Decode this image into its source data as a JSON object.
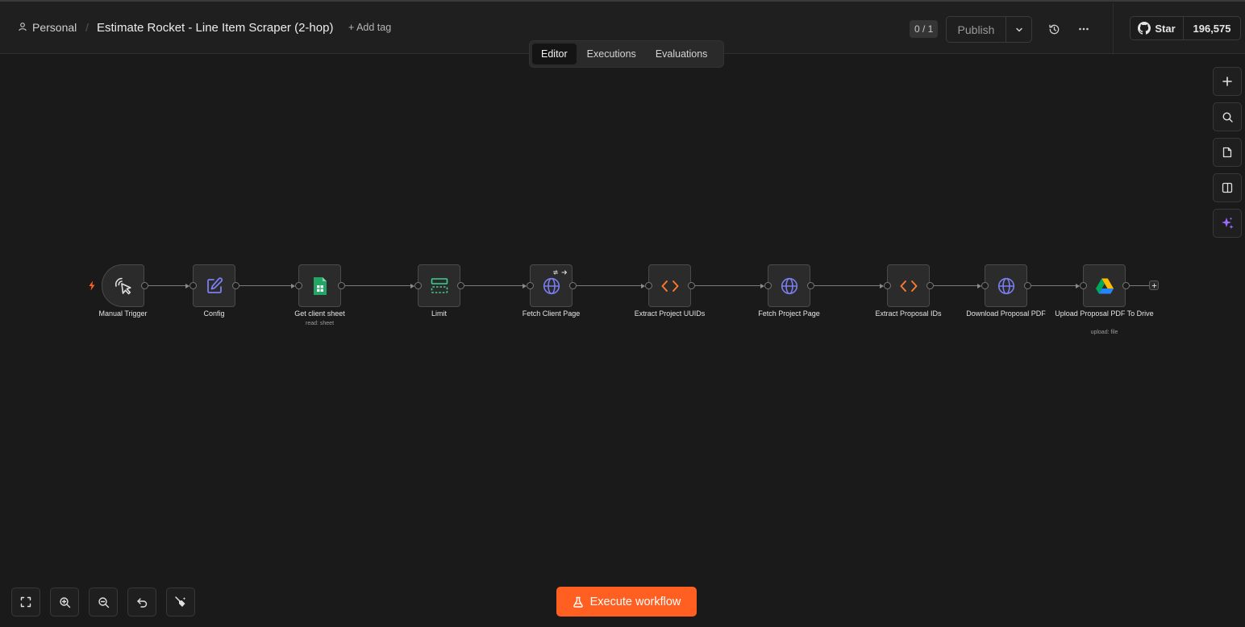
{
  "header": {
    "project": "Personal",
    "workflow_title": "Estimate Rocket - Line Item Scraper (2-hop)",
    "add_tag": "+ Add tag",
    "counter": "0 / 1",
    "publish": "Publish",
    "github_star": "Star",
    "github_count": "196,575"
  },
  "tabs": [
    "Editor",
    "Executions",
    "Evaluations"
  ],
  "active_tab": "Editor",
  "nodes": [
    {
      "label": "Manual Trigger",
      "icon": "cursor-click-icon"
    },
    {
      "label": "Config",
      "icon": "edit-icon"
    },
    {
      "label": "Get client sheet",
      "sub": "read: sheet",
      "icon": "google-sheets-icon"
    },
    {
      "label": "Limit",
      "icon": "limit-icon"
    },
    {
      "label": "Fetch Client Page",
      "icon": "globe-icon"
    },
    {
      "label": "Extract Project UUIDs",
      "icon": "code-icon"
    },
    {
      "label": "Fetch Project Page",
      "icon": "globe-icon"
    },
    {
      "label": "Extract Proposal IDs",
      "icon": "code-icon"
    },
    {
      "label": "Download Proposal PDF",
      "icon": "globe-icon"
    },
    {
      "label": "Upload Proposal PDF To Drive",
      "sub": "upload: file",
      "icon": "google-drive-icon"
    }
  ],
  "execute_button": "Execute workflow",
  "colors": {
    "accent": "#ff5f20",
    "node_icon_blue": "#7b7ef0",
    "code_orange": "#ff7a2e",
    "sheets_green": "#23a566",
    "limit_green": "#3ecf8e",
    "ai_purple": "#9b6bff"
  }
}
